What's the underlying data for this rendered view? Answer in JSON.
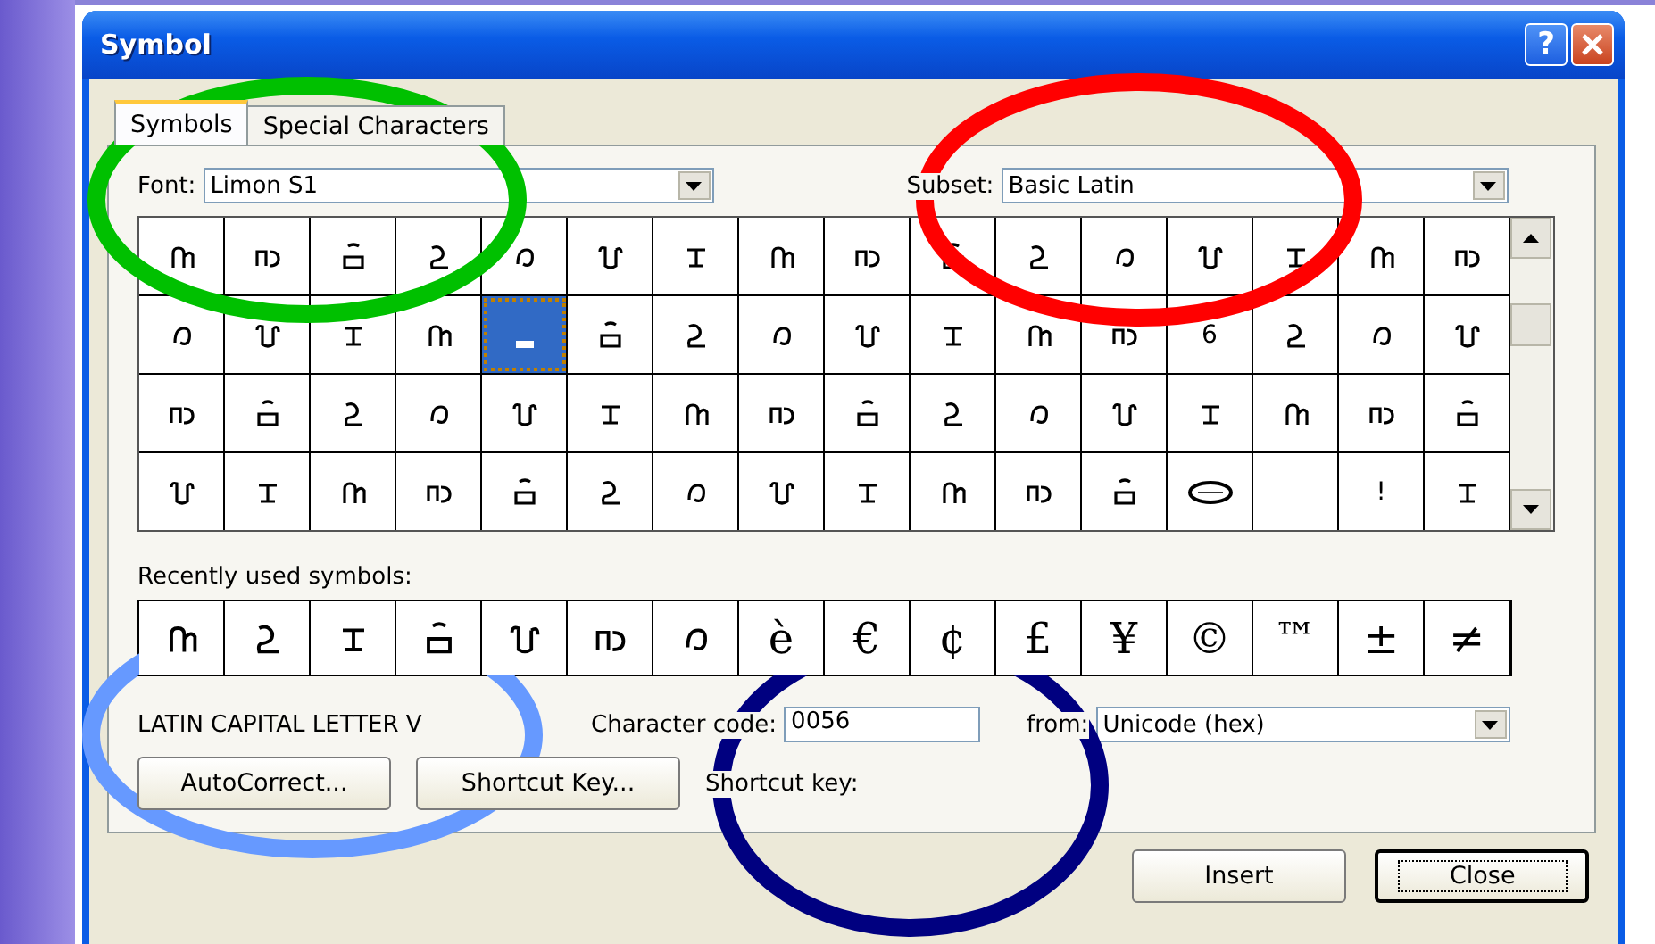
{
  "window": {
    "title": "Symbol",
    "title_buttons": [
      {
        "kind": "help",
        "label": "?"
      },
      {
        "kind": "close"
      }
    ]
  },
  "tabs": [
    {
      "label": "Symbols",
      "selected": true
    },
    {
      "label": "Special Characters",
      "selected": false
    }
  ],
  "font": {
    "label": "Font:",
    "value": "Limon S1"
  },
  "subset": {
    "label": "Subset:",
    "value": "Basic Latin"
  },
  "grid": {
    "rows": [
      [
        {
          "kind": "glyph",
          "selected": false
        },
        {
          "kind": "glyph",
          "selected": false
        },
        {
          "kind": "glyph",
          "selected": false
        },
        {
          "kind": "glyph",
          "selected": false
        },
        {
          "kind": "glyph",
          "selected": false
        },
        {
          "kind": "glyph",
          "selected": false
        },
        {
          "kind": "glyph",
          "selected": false
        },
        {
          "kind": "glyph",
          "selected": false
        },
        {
          "kind": "glyph",
          "selected": false
        },
        {
          "kind": "glyph",
          "selected": false
        },
        {
          "kind": "glyph",
          "selected": false
        },
        {
          "kind": "glyph",
          "selected": false
        },
        {
          "kind": "glyph",
          "selected": false
        },
        {
          "kind": "glyph",
          "selected": false
        },
        {
          "kind": "glyph",
          "selected": false
        },
        {
          "kind": "glyph",
          "selected": false
        }
      ],
      [
        {
          "kind": "glyph",
          "selected": false
        },
        {
          "kind": "glyph",
          "selected": false
        },
        {
          "kind": "glyph",
          "selected": false
        },
        {
          "kind": "glyph",
          "selected": false
        },
        {
          "kind": "glyph",
          "selected": true
        },
        {
          "kind": "glyph",
          "selected": false
        },
        {
          "kind": "glyph",
          "selected": false
        },
        {
          "kind": "glyph",
          "selected": false
        },
        {
          "kind": "glyph",
          "selected": false
        },
        {
          "kind": "glyph",
          "selected": false
        },
        {
          "kind": "glyph",
          "selected": false
        },
        {
          "kind": "glyph",
          "selected": false
        },
        {
          "kind": "text",
          "text": "6",
          "selected": false
        },
        {
          "kind": "glyph",
          "selected": false
        },
        {
          "kind": "glyph",
          "selected": false
        },
        {
          "kind": "glyph",
          "selected": false
        }
      ],
      [
        {
          "kind": "glyph",
          "selected": false
        },
        {
          "kind": "glyph",
          "selected": false
        },
        {
          "kind": "glyph",
          "selected": false
        },
        {
          "kind": "glyph",
          "selected": false
        },
        {
          "kind": "glyph",
          "selected": false
        },
        {
          "kind": "glyph",
          "selected": false
        },
        {
          "kind": "glyph",
          "selected": false
        },
        {
          "kind": "glyph",
          "selected": false
        },
        {
          "kind": "glyph",
          "selected": false
        },
        {
          "kind": "glyph",
          "selected": false
        },
        {
          "kind": "glyph",
          "selected": false
        },
        {
          "kind": "glyph",
          "selected": false
        },
        {
          "kind": "glyph",
          "selected": false
        },
        {
          "kind": "glyph",
          "selected": false
        },
        {
          "kind": "glyph",
          "selected": false
        },
        {
          "kind": "glyph",
          "selected": false
        }
      ],
      [
        {
          "kind": "glyph",
          "selected": false
        },
        {
          "kind": "glyph",
          "selected": false
        },
        {
          "kind": "glyph",
          "selected": false
        },
        {
          "kind": "glyph",
          "selected": false
        },
        {
          "kind": "glyph",
          "selected": false
        },
        {
          "kind": "glyph",
          "selected": false
        },
        {
          "kind": "glyph",
          "selected": false
        },
        {
          "kind": "glyph",
          "selected": false
        },
        {
          "kind": "glyph",
          "selected": false
        },
        {
          "kind": "glyph",
          "selected": false
        },
        {
          "kind": "glyph",
          "selected": false
        },
        {
          "kind": "glyph",
          "selected": false
        },
        {
          "kind": "oval",
          "selected": false
        },
        {
          "kind": "empty",
          "selected": false
        },
        {
          "kind": "text",
          "text": "!",
          "selected": false
        },
        {
          "kind": "glyph",
          "selected": false
        }
      ]
    ]
  },
  "recent": {
    "label": "Recently used symbols:",
    "cells": [
      {
        "kind": "glyph"
      },
      {
        "kind": "glyph"
      },
      {
        "kind": "glyph"
      },
      {
        "kind": "glyph"
      },
      {
        "kind": "glyph"
      },
      {
        "kind": "glyph"
      },
      {
        "kind": "glyph"
      },
      {
        "kind": "text",
        "text": "è"
      },
      {
        "kind": "text",
        "text": "€"
      },
      {
        "kind": "text",
        "text": "¢"
      },
      {
        "kind": "text",
        "text": "£"
      },
      {
        "kind": "text",
        "text": "¥"
      },
      {
        "kind": "text",
        "text": "©"
      },
      {
        "kind": "text",
        "text": "™"
      },
      {
        "kind": "text",
        "text": "±"
      },
      {
        "kind": "text",
        "text": "≠"
      }
    ]
  },
  "description": "LATIN CAPITAL LETTER V",
  "character_code": {
    "label": "Character code:",
    "value": "0056"
  },
  "from": {
    "label": "from:",
    "value": "Unicode (hex)"
  },
  "autocorrect_button": "AutoCorrect...",
  "shortcut_key_button": "Shortcut Key...",
  "shortcut_key_label": "Shortcut key:",
  "buttons": [
    {
      "label": "Insert",
      "default": false
    },
    {
      "label": "Close",
      "default": true
    }
  ],
  "annotations": [
    {
      "color": "#00c000"
    },
    {
      "color": "#ff0000"
    },
    {
      "color": "#6699ff"
    },
    {
      "color": "#000080"
    }
  ]
}
